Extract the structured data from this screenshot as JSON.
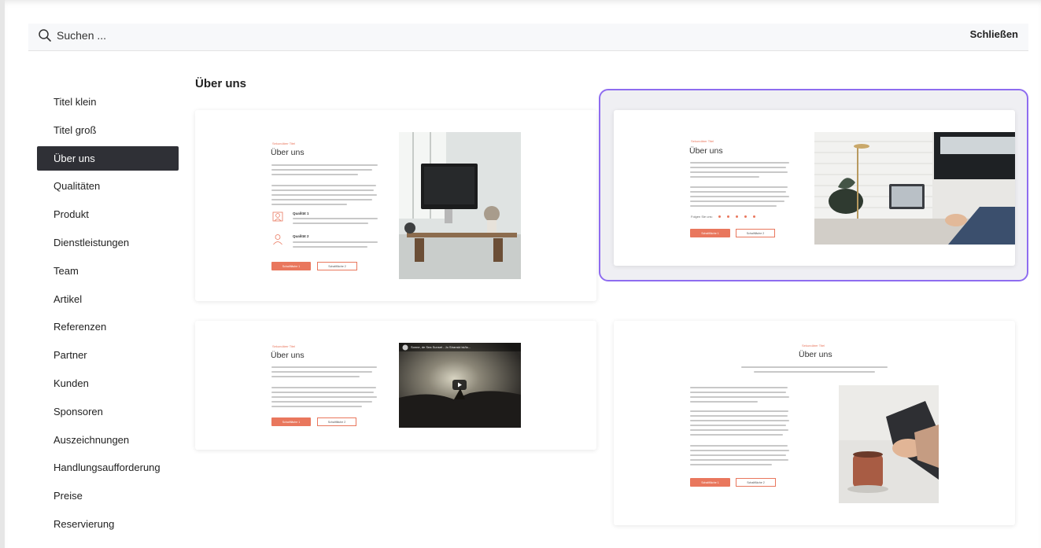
{
  "search": {
    "label": "Suchen ..."
  },
  "close_label": "Schließen",
  "sidebar": {
    "items": [
      {
        "label": "Titel klein",
        "active": false
      },
      {
        "label": "Titel groß",
        "active": false
      },
      {
        "label": "Über uns",
        "active": true
      },
      {
        "label": "Qualitäten",
        "active": false
      },
      {
        "label": "Produkt",
        "active": false
      },
      {
        "label": "Dienstleistungen",
        "active": false
      },
      {
        "label": "Team",
        "active": false
      },
      {
        "label": "Artikel",
        "active": false
      },
      {
        "label": "Referenzen",
        "active": false
      },
      {
        "label": "Partner",
        "active": false
      },
      {
        "label": "Kunden",
        "active": false
      },
      {
        "label": "Sponsoren",
        "active": false
      },
      {
        "label": "Auszeichnungen",
        "active": false
      },
      {
        "label": "Handlungsaufforderung",
        "active": false
      },
      {
        "label": "Preise",
        "active": false
      },
      {
        "label": "Reservierung",
        "active": false
      }
    ]
  },
  "section_title": "Über uns",
  "templates": {
    "t1": {
      "eyebrow": "Sekundärer Titel",
      "title": "Über uns",
      "feature1": "Qualität 1",
      "feature2": "Qualität 2",
      "btn1": "Schaltfläche 1",
      "btn2": "Schaltfläche 2"
    },
    "t2": {
      "eyebrow": "Sekundärer Titel",
      "title": "Über uns",
      "social_label": "Folgen Sie uns:",
      "btn1": "Schaltfläche 1",
      "btn2": "Schaltfläche 2"
    },
    "t3": {
      "eyebrow": "Sekundärer Titel",
      "title": "Über uns",
      "video_title": "Sonne, de Sea Sunset - Jo Stranski ist/la...",
      "btn1": "Schaltfläche 1",
      "btn2": "Schaltfläche 2"
    },
    "t4": {
      "eyebrow": "Sekundärer Titel",
      "title": "Über uns",
      "btn1": "Schaltfläche 1",
      "btn2": "Schaltfläche 2"
    }
  },
  "colors": {
    "accent": "#e9775d",
    "selection": "#8e6cf0",
    "active_bg": "#2f3036"
  }
}
